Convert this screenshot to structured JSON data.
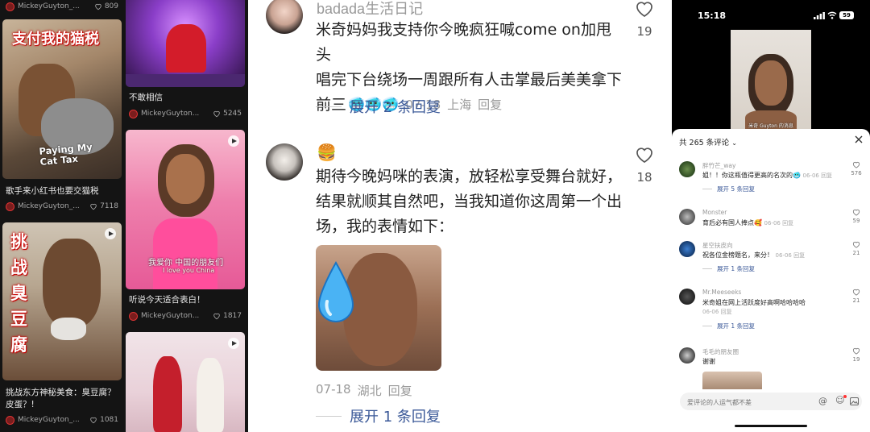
{
  "feed": {
    "col1": [
      {
        "caption": "",
        "author": "MickeyGuyton_...",
        "likes": "809"
      },
      {
        "caption": "歌手来小红书也要交猫税",
        "author": "MickeyGuyton_...",
        "likes": "7118",
        "overlay_title": "支付我的猫税",
        "overlay_sub": "Paying My Cat Tax"
      },
      {
        "caption": "挑战东方神秘美食：臭豆腐？皮蛋？!",
        "author": "MickeyGuyton_...",
        "likes": "1081",
        "overlay_title": "挑战臭豆腐"
      }
    ],
    "col2": [
      {
        "caption": "不敢相信",
        "author": "MickeyGuyton...",
        "likes": "5245"
      },
      {
        "caption": "听说今天适合表白！",
        "author": "MickeyGuyton...",
        "likes": "1817",
        "overlay_line1": "我爱你 中国的朋友们",
        "overlay_line2": "I love you China"
      },
      {
        "caption": "",
        "author": "",
        "likes": ""
      }
    ]
  },
  "comments": [
    {
      "username": "badada生活日记",
      "text_lines": [
        "米奇妈妈我支持你今晚疯狂喊come on加甩头",
        "唱完下台绕场一周跟所有人击掌最后美美拿下",
        "前三"
      ],
      "emoji": "🥶🥶🥶",
      "date": "07-18",
      "location": "上海",
      "reply_label": "回复",
      "likes": "19",
      "expand_label": "展开 2 条回复"
    },
    {
      "username": "🍔",
      "text_lines": [
        "期待今晚妈咪的表演，放轻松享受舞台就好，",
        "结果就顺其自然吧，当我知道你这周第一个出",
        "场，我的表情如下："
      ],
      "date": "07-18",
      "location": "湖北",
      "reply_label": "回复",
      "likes": "18",
      "expand_label": "展开 1 条回复"
    }
  ],
  "phone": {
    "time": "15:18",
    "battery": "59",
    "video_caption": "米奇 Guyton 的消息",
    "sheet_title": "共 265 条评论",
    "items": [
      {
        "name": "胖竹芒_way",
        "text": "姐！！你这瓶值得更高的名次的🥶",
        "date": "06-06 回复",
        "expand": "展开 5 条回复",
        "likes": "576"
      },
      {
        "name": "Monster",
        "text": "育后必有国人捧点🥰",
        "date": "06-06 回复",
        "expand": "",
        "likes": "59"
      },
      {
        "name": "星空扶皮向",
        "text": "祝各位金榜题名，来分！",
        "date": "06-06 回复",
        "expand": "展开 1 条回复",
        "likes": "21"
      },
      {
        "name": "Mr.Meeseeks",
        "text": "米奇姐在网上活跃度好高啊哈哈哈哈",
        "date": "06-06 回复",
        "expand": "展开 1 条回复",
        "likes": "21"
      },
      {
        "name": "毛毛的朋友圈",
        "text": "谢谢",
        "date": "",
        "expand": "",
        "likes": "19"
      }
    ],
    "input_placeholder": "爱评论的人运气都不差"
  }
}
